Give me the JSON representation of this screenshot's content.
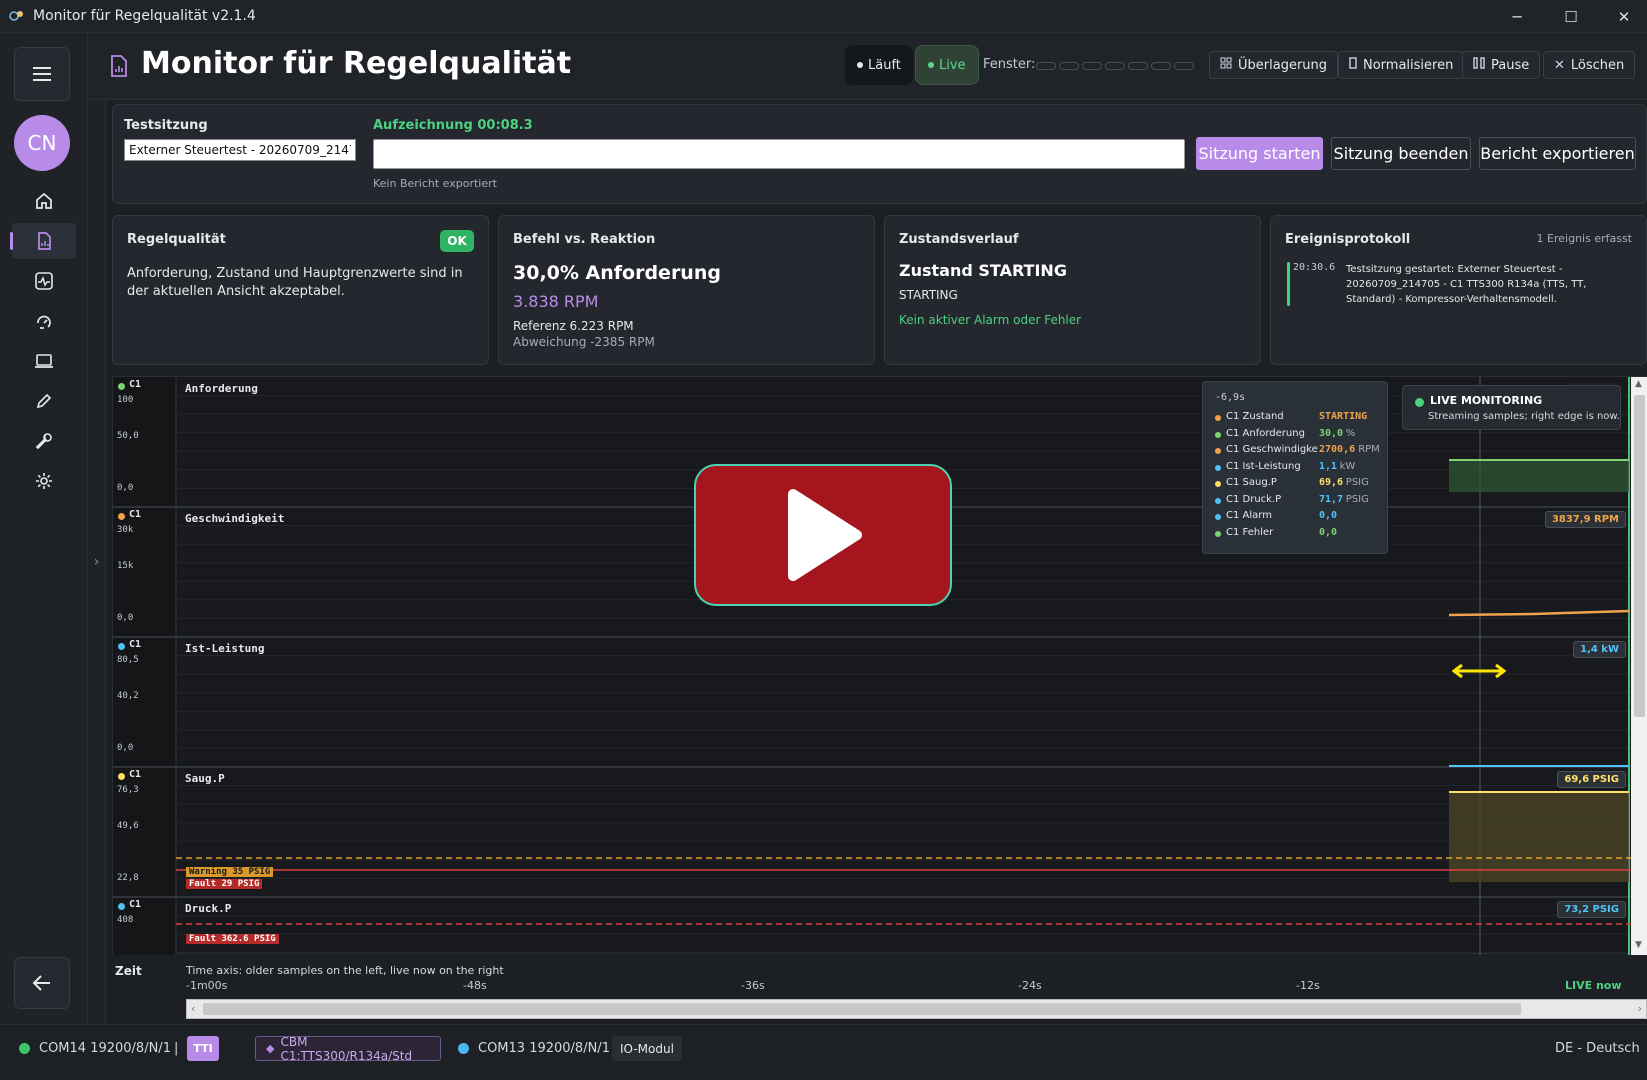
{
  "window": {
    "title": "Monitor für Regelqualität v2.1.4"
  },
  "header": {
    "title": "Monitor für Regelqualität",
    "status_running": "Läuft",
    "status_live": "Live",
    "window_label": "Fenster:",
    "overlay_label": "Überlagerung",
    "normalize_label": "Normalisieren",
    "pause_label": "Pause",
    "clear_label": "Löschen"
  },
  "sidebar": {
    "avatar_initials": "CN"
  },
  "session": {
    "label": "Testsitzung",
    "name_value": "Externer Steuertest - 20260709_214705",
    "recording": "Aufzeichnung 00:08.3",
    "report_status": "Kein Bericht exportiert",
    "start_label": "Sitzung starten",
    "end_label": "Sitzung beenden",
    "export_label": "Bericht exportieren"
  },
  "cards": {
    "quality": {
      "title": "Regelqualität",
      "badge": "OK",
      "text": "Anforderung, Zustand und Hauptgrenzwerte sind in der aktuellen Ansicht akzeptabel."
    },
    "command": {
      "title": "Befehl vs. Reaktion",
      "demand": "30,0% Anforderung",
      "rpm": "3.838 RPM",
      "reference": "Referenz 6.223 RPM",
      "deviation": "Abweichung -2385 RPM"
    },
    "state": {
      "title": "Zustandsverlauf",
      "state_heading": "Zustand STARTING",
      "state_value": "STARTING",
      "alarm_text": "Kein aktiver Alarm oder Fehler"
    },
    "events": {
      "title": "Ereignisprotokoll",
      "count": "1 Ereignis erfasst",
      "time": "20:30.6",
      "text": "Testsitzung gestartet: Externer Steuertest - 20260709_214705 - C1 TTS300 R134a (TTS, TT, Standard) - Kompressor-Verhaltensmodell."
    }
  },
  "lanes": [
    {
      "channel": "C1",
      "name": "Anforderung",
      "ticks": [
        "100",
        "50,0",
        "0,0"
      ],
      "color": "#7ed36f",
      "readout": "30,0 %"
    },
    {
      "channel": "C1",
      "name": "Geschwindigkeit",
      "ticks": [
        "30k",
        "15k",
        "0,0"
      ],
      "color": "#f0a24a",
      "readout": "3837,9 RPM"
    },
    {
      "channel": "C1",
      "name": "Ist-Leistung",
      "ticks": [
        "80,5",
        "40,2",
        "0,0"
      ],
      "color": "#4fc3f7",
      "readout": "1,4 kW"
    },
    {
      "channel": "C1",
      "name": "Saug.P",
      "ticks": [
        "76,3",
        "49,6",
        "22,8"
      ],
      "color": "#ffe066",
      "readout": "69,6 PSIG"
    },
    {
      "channel": "C1",
      "name": "Druck.P",
      "ticks": [
        "408"
      ],
      "color": "#4fc3f7",
      "readout": "73,2 PSIG"
    }
  ],
  "thresholds": {
    "warning": "Warning 35 PSIG",
    "fault": "Fault 29 PSIG",
    "fault_druck": "Fault 362.6 PSIG"
  },
  "tooltip": {
    "time": "-6,9s",
    "rows": [
      {
        "label": "C1 Zustand",
        "value": "STARTING",
        "unit": "",
        "color": "#f0a24a",
        "vcolor": "#f0a24a"
      },
      {
        "label": "C1 Anforderung",
        "value": "30,0",
        "unit": "%",
        "color": "#7ed36f",
        "vcolor": "#7ed36f"
      },
      {
        "label": "C1 Geschwindigkeit",
        "value": "2700,6",
        "unit": "RPM",
        "color": "#f0a24a",
        "vcolor": "#f0a24a"
      },
      {
        "label": "C1 Ist-Leistung",
        "value": "1,1",
        "unit": "kW",
        "color": "#4fc3f7",
        "vcolor": "#4fc3f7"
      },
      {
        "label": "C1 Saug.P",
        "value": "69,6",
        "unit": "PSIG",
        "color": "#ffe066",
        "vcolor": "#ffe066"
      },
      {
        "label": "C1 Druck.P",
        "value": "71,7",
        "unit": "PSIG",
        "color": "#4fc3f7",
        "vcolor": "#4fc3f7"
      },
      {
        "label": "C1 Alarm",
        "value": "0,0",
        "unit": "",
        "color": "#4fc3f7",
        "vcolor": "#4fc3f7"
      },
      {
        "label": "C1 Fehler",
        "value": "0,0",
        "unit": "",
        "color": "#7ed36f",
        "vcolor": "#7ed36f"
      }
    ]
  },
  "live_box": {
    "title": "LIVE MONITORING",
    "subtitle": "Streaming samples; right edge is now."
  },
  "time_axis": {
    "label": "Zeit",
    "hint": "Time axis: older samples on the left, live now on the right",
    "ticks": [
      "-1m00s",
      "-48s",
      "-36s",
      "-24s",
      "-12s",
      "LIVE now"
    ]
  },
  "statusbar": {
    "port1": "COM14 19200/8/N/1",
    "separator": "|",
    "badge1": "TTI",
    "cbm": "CBM C1:TTS300/R134a/Std",
    "port2": "COM13 19200/8/N/1",
    "module": "IO-Modul",
    "language": "DE - Deutsch"
  },
  "colors": {
    "accent": "#b98be8",
    "ok": "#2fb463",
    "live": "#4ad281",
    "play": "#a4151d"
  }
}
